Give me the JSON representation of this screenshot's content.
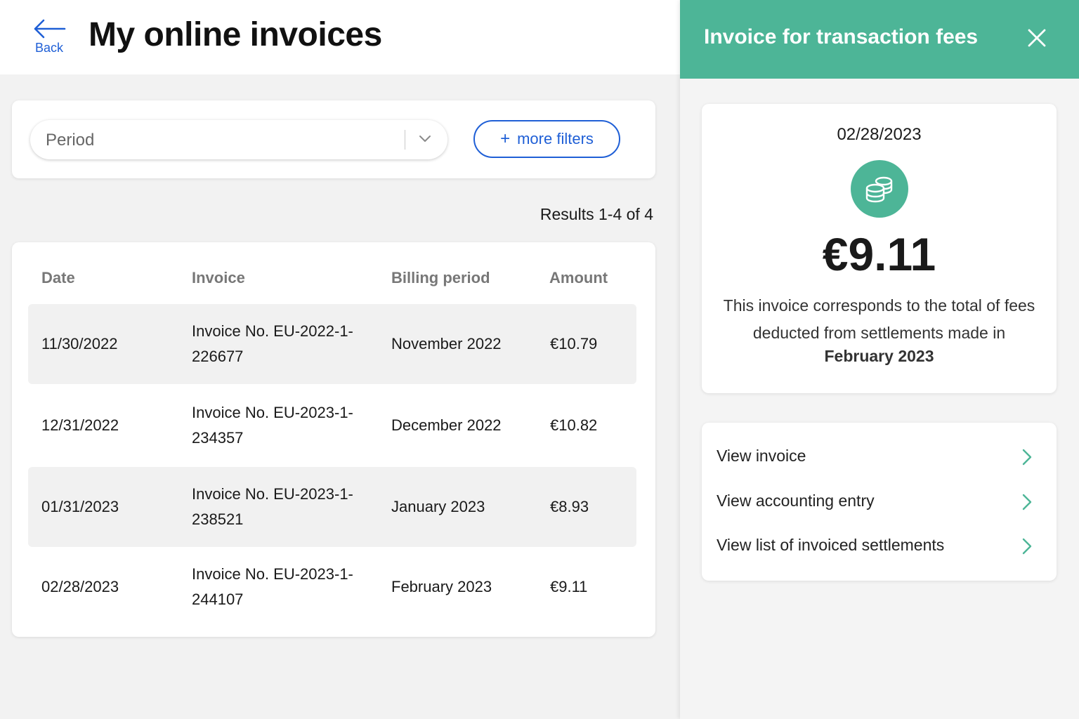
{
  "header": {
    "back_label": "Back",
    "title": "My online invoices"
  },
  "filters": {
    "period_placeholder": "Period",
    "more_filters_label": "more filters",
    "more_filters_plus": "+"
  },
  "results_text": "Results 1-4 of 4",
  "table": {
    "columns": [
      "Date",
      "Invoice",
      "Billing period",
      "Amount"
    ],
    "rows": [
      {
        "date": "11/30/2022",
        "invoice": "Invoice No. EU-2022-1-226677",
        "billing_period": "November 2022",
        "amount": "€10.79"
      },
      {
        "date": "12/31/2022",
        "invoice": "Invoice No. EU-2023-1-234357",
        "billing_period": "December 2022",
        "amount": "€10.82"
      },
      {
        "date": "01/31/2023",
        "invoice": "Invoice No. EU-2023-1-238521",
        "billing_period": "January 2023",
        "amount": "€8.93"
      },
      {
        "date": "02/28/2023",
        "invoice": "Invoice No. EU-2023-1-244107",
        "billing_period": "February 2023",
        "amount": "€9.11"
      }
    ]
  },
  "panel": {
    "title": "Invoice for transaction fees",
    "date": "02/28/2023",
    "amount": "€9.11",
    "description": "This invoice corresponds to the total of fees deducted from settlements made in",
    "month": "February 2023",
    "links": [
      {
        "label": "View invoice"
      },
      {
        "label": "View accounting entry"
      },
      {
        "label": "View list of invoiced settlements"
      }
    ]
  },
  "colors": {
    "accent_green": "#4db597",
    "link_blue": "#1f5fd6"
  },
  "icons": {
    "back": "arrow-left-icon",
    "chevron_down": "chevron-down-icon",
    "close": "close-icon",
    "coins": "coins-icon",
    "chevron_right": "chevron-right-icon"
  }
}
